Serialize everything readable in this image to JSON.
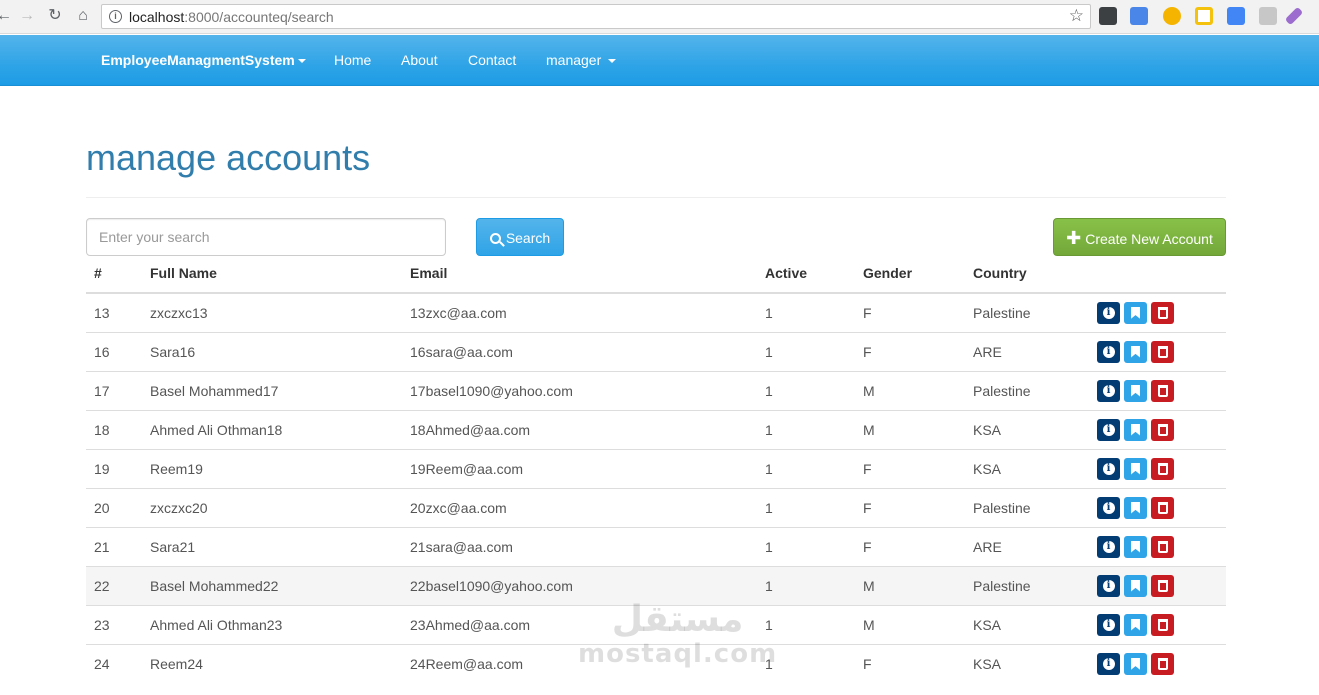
{
  "browser": {
    "url_host": "localhost",
    "url_path": ":8000/accounteq/search",
    "back_icon": "back-arrow-icon",
    "forward_icon": "forward-arrow-icon",
    "reload_icon": "reload-icon",
    "home_icon": "home-icon"
  },
  "navbar": {
    "brand": "EmployeeManagmentSystem",
    "items": [
      "Home",
      "About",
      "Contact"
    ],
    "user_menu": "manager"
  },
  "page": {
    "title": "manage accounts"
  },
  "search": {
    "placeholder": "Enter your search",
    "value": "",
    "button_label": "Search"
  },
  "create_button_label": "Create New Account",
  "table": {
    "headers": [
      "#",
      "Full Name",
      "Email",
      "Active",
      "Gender",
      "Country"
    ],
    "rows": [
      [
        "13",
        "zxczxc13",
        "13zxc@aa.com",
        "1",
        "F",
        "Palestine"
      ],
      [
        "16",
        "Sara16",
        "16sara@aa.com",
        "1",
        "F",
        "ARE"
      ],
      [
        "17",
        "Basel Mohammed17",
        "17basel1090@yahoo.com",
        "1",
        "M",
        "Palestine"
      ],
      [
        "18",
        "Ahmed Ali Othman18",
        "18Ahmed@aa.com",
        "1",
        "M",
        "KSA"
      ],
      [
        "19",
        "Reem19",
        "19Reem@aa.com",
        "1",
        "F",
        "KSA"
      ],
      [
        "20",
        "zxczxc20",
        "20zxc@aa.com",
        "1",
        "F",
        "Palestine"
      ],
      [
        "21",
        "Sara21",
        "21sara@aa.com",
        "1",
        "F",
        "ARE"
      ],
      [
        "22",
        "Basel Mohammed22",
        "22basel1090@yahoo.com",
        "1",
        "M",
        "Palestine"
      ],
      [
        "23",
        "Ahmed Ali Othman23",
        "23Ahmed@aa.com",
        "1",
        "M",
        "KSA"
      ],
      [
        "24",
        "Reem24",
        "24Reem@aa.com",
        "1",
        "F",
        "KSA"
      ]
    ],
    "hovered_row": "22"
  },
  "watermark": {
    "arabic": "مستقل",
    "latin": "mostaql.com"
  },
  "colors": {
    "navbar": "#2fa4e7",
    "title": "#317eac",
    "create_button": "#73a839",
    "info_button": "#033c73",
    "bookmark_button": "#2fa4e7",
    "delete_button": "#c71c22"
  }
}
